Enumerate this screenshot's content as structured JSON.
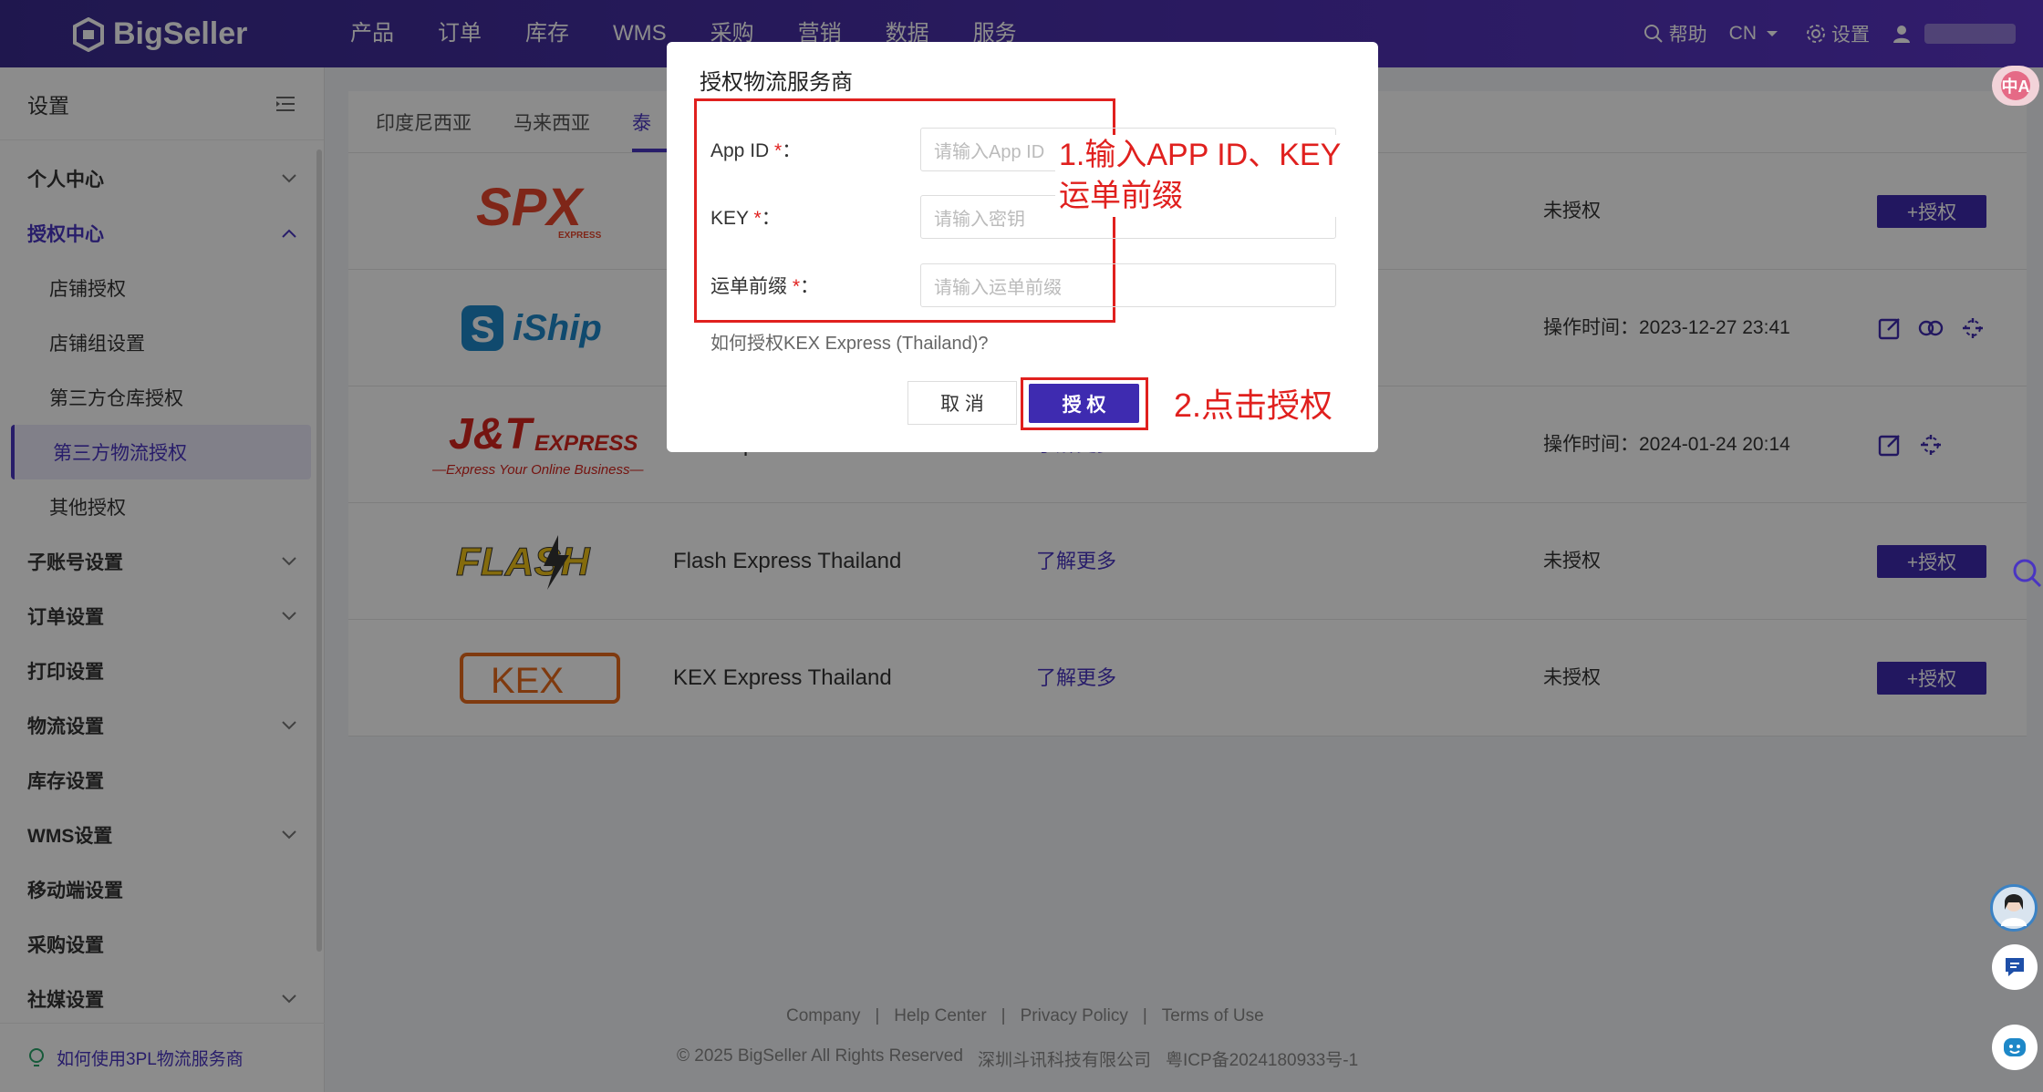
{
  "app": {
    "brand": "BigSeller",
    "nav": [
      "产品",
      "订单",
      "库存",
      "WMS",
      "采购",
      "营销",
      "数据",
      "服务"
    ],
    "help_label": "帮助",
    "lang_label": "CN",
    "settings_label": "设置"
  },
  "sidebar": {
    "title": "设置",
    "items": [
      {
        "label": "个人中心"
      },
      {
        "label": "授权中心"
      },
      {
        "label": "店铺授权"
      },
      {
        "label": "店铺组设置"
      },
      {
        "label": "第三方仓库授权"
      },
      {
        "label": "第三方物流授权"
      },
      {
        "label": "其他授权"
      },
      {
        "label": "子账号设置"
      },
      {
        "label": "订单设置"
      },
      {
        "label": "打印设置"
      },
      {
        "label": "物流设置"
      },
      {
        "label": "库存设置"
      },
      {
        "label": "WMS设置"
      },
      {
        "label": "移动端设置"
      },
      {
        "label": "采购设置"
      },
      {
        "label": "社媒设置"
      }
    ],
    "footer_link": "如何使用3PL物流服务商"
  },
  "tabs": [
    "印度尼西亚",
    "马来西亚",
    "泰"
  ],
  "providers": [
    {
      "logo_text": "SPX",
      "logo_sub": "EXPRESS",
      "name": "",
      "more": "",
      "status": "未授权",
      "action": "+授权"
    },
    {
      "logo_text": "iShip",
      "name": "",
      "more": "",
      "status": "操作时间：2023-12-27 23:41",
      "action": ""
    },
    {
      "logo_text": "J&T",
      "logo_sub": "EXPRESS",
      "logo_tagline": "—Express Your Online Business—",
      "name": "J&T Express Thailand",
      "more": "了解更多",
      "status": "操作时间：2024-01-24 20:14",
      "action": ""
    },
    {
      "logo_text": "FLASH",
      "name": "Flash Express Thailand",
      "more": "了解更多",
      "status": "未授权",
      "action": "+授权"
    },
    {
      "logo_text": "KEX",
      "name": "KEX Express Thailand",
      "more": "了解更多",
      "status": "未授权",
      "action": "+授权"
    }
  ],
  "footer": {
    "links": [
      "Company",
      "|",
      "Help Center",
      "|",
      "Privacy Policy",
      "|",
      "Terms of Use"
    ],
    "copyright": "© 2025 BigSeller All Rights Reserved",
    "company": "深圳斗讯科技有限公司",
    "icp": "粤ICP备2024180933号-1"
  },
  "modal": {
    "title": "授权物流服务商",
    "fields": [
      {
        "label": "App ID",
        "required": "*",
        "colon": "：",
        "placeholder": "请输入App ID"
      },
      {
        "label": "KEY",
        "required": "*",
        "colon": "：",
        "placeholder": "请输入密钥"
      },
      {
        "label": "运单前缀",
        "required": "*",
        "colon": "：",
        "placeholder": "请输入运单前缀"
      }
    ],
    "howto": "如何授权KEX Express (Thailand)?",
    "cancel": "取 消",
    "ok": "授 权",
    "annotation1_line1": "1.输入APP ID、KEY",
    "annotation1_line2": "运单前缀",
    "annotation2": "2.点击授权"
  },
  "translate_badge": "中A",
  "colors": {
    "primary": "#3e2bb0",
    "annotation": "#e0201e",
    "topbar": "#4a32b4"
  }
}
